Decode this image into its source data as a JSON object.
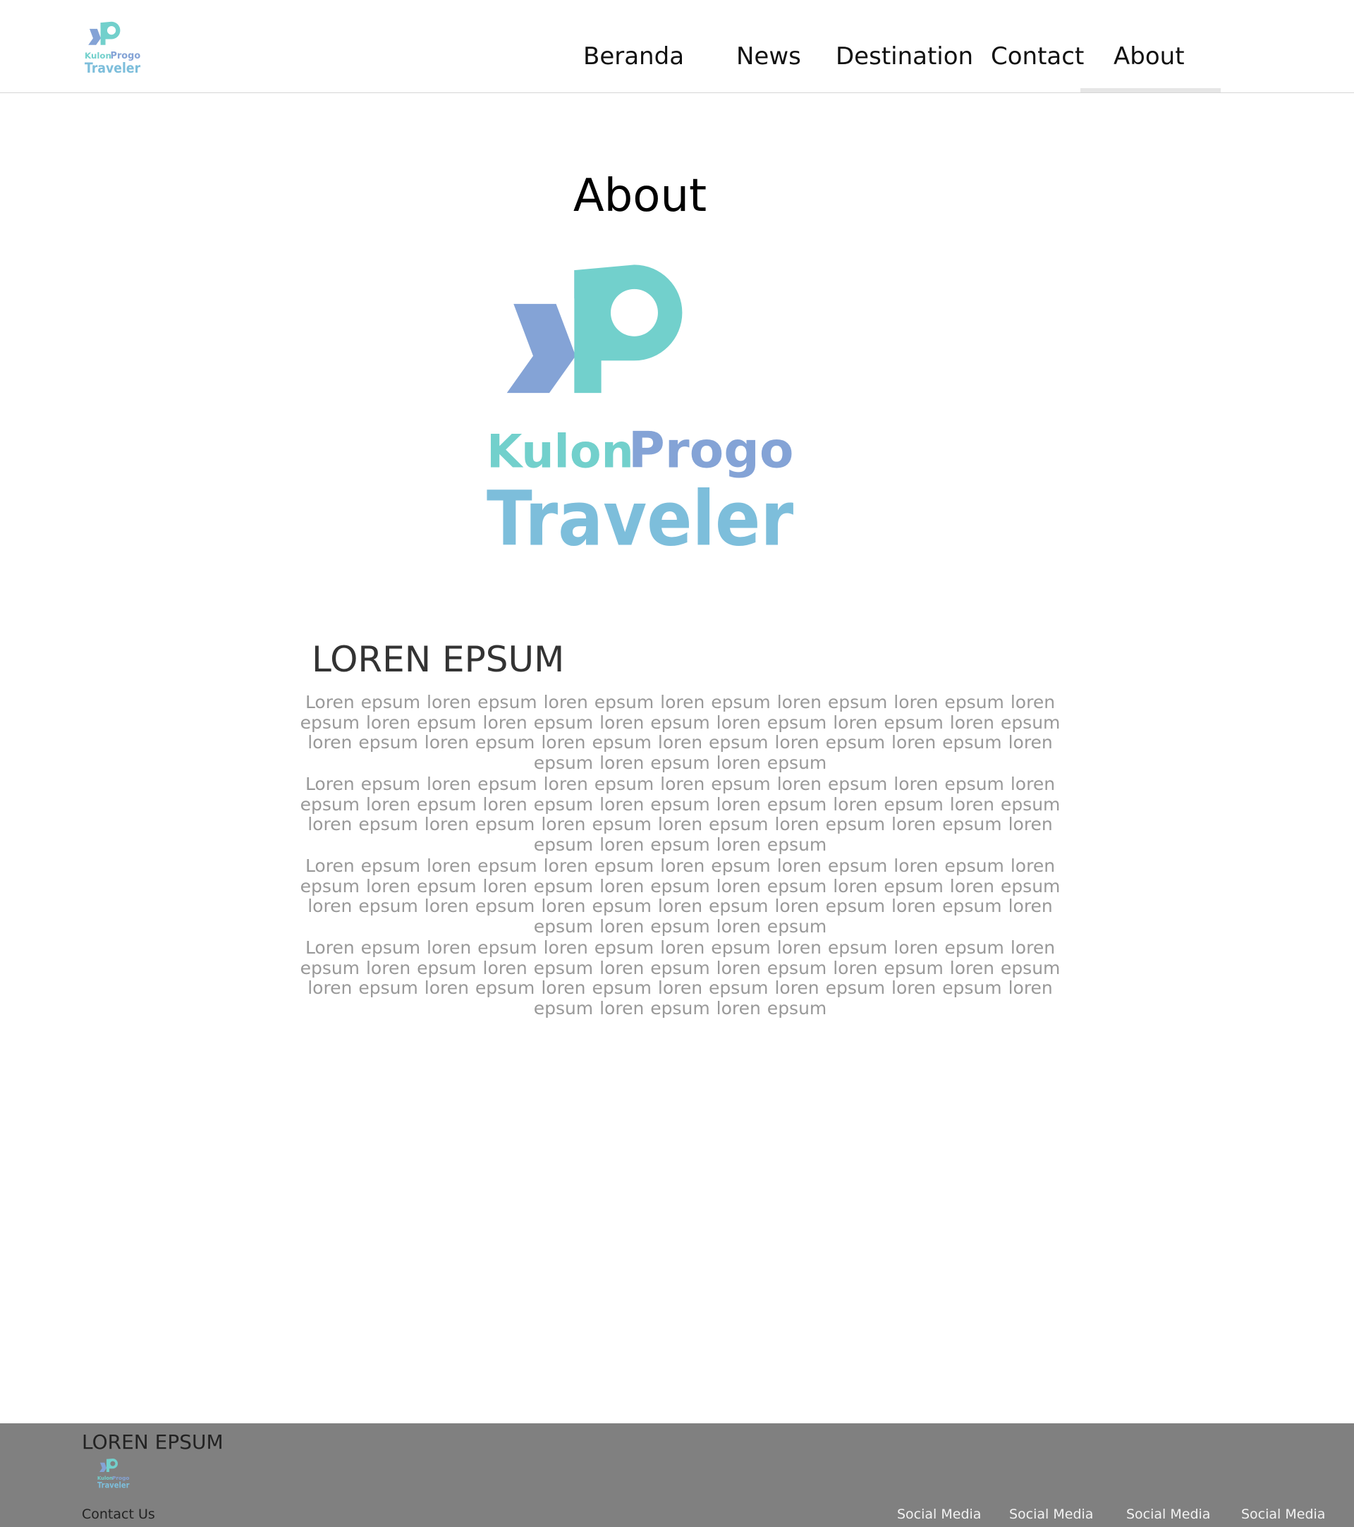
{
  "header": {
    "logo_text": [
      "Kulon",
      "Progo",
      "Traveler"
    ],
    "nav": {
      "beranda": "Beranda",
      "news": "News",
      "destination": "Destination",
      "contact": "Contact",
      "about": "About"
    },
    "active_nav": "about"
  },
  "main": {
    "title": "About",
    "hero_logo_text": [
      "Kulon",
      "Progo",
      "Traveler"
    ],
    "section_heading": "LOREN EPSUM",
    "paragraphs": [
      "Loren epsum loren epsum loren epsum loren epsum loren epsum loren epsum loren epsum loren epsum loren epsum loren epsum loren epsum loren epsum loren epsum loren epsum loren epsum loren epsum loren epsum loren epsum loren epsum loren epsum loren epsum loren epsum",
      "Loren epsum loren epsum loren epsum loren epsum loren epsum loren epsum loren epsum loren epsum loren epsum loren epsum loren epsum loren epsum loren epsum loren epsum loren epsum loren epsum loren epsum loren epsum loren epsum loren epsum loren epsum loren epsum",
      "Loren epsum loren epsum loren epsum loren epsum loren epsum loren epsum loren epsum loren epsum loren epsum loren epsum loren epsum loren epsum loren epsum loren epsum loren epsum loren epsum loren epsum loren epsum loren epsum loren epsum loren epsum loren epsum",
      "Loren epsum loren epsum loren epsum loren epsum loren epsum loren epsum loren epsum loren epsum loren epsum loren epsum loren epsum loren epsum loren epsum loren epsum loren epsum loren epsum loren epsum loren epsum loren epsum loren epsum loren epsum loren epsum"
    ]
  },
  "footer": {
    "heading": "LOREN EPSUM",
    "logo_text": [
      "Kulon",
      "Progo",
      "Traveler"
    ],
    "contact": "Contact Us",
    "social": [
      "Social Media",
      "Social Media",
      "Social Media",
      "Social Media"
    ]
  },
  "colors": {
    "brand_teal": "#72d0cc",
    "brand_periwinkle": "#84a3d6",
    "brand_sky": "#7dbedb",
    "footer_bg": "#808080",
    "body_text": "#999999"
  },
  "icons": {
    "logo": "kp-logo-icon"
  }
}
